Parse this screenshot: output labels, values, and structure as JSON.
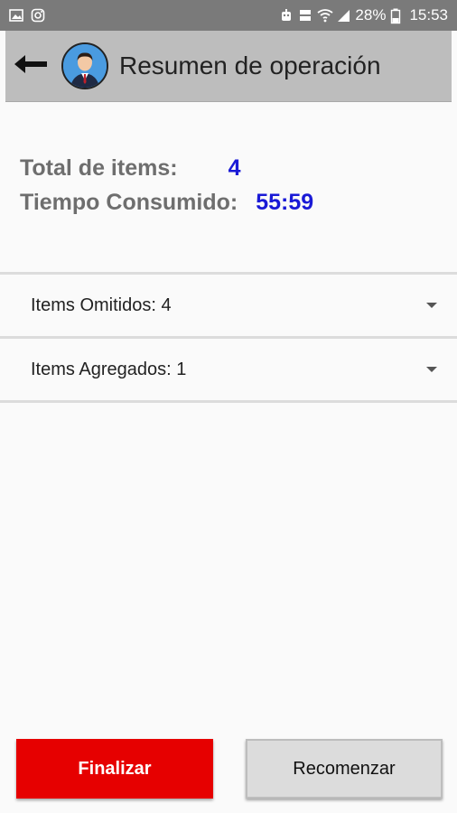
{
  "status_bar": {
    "battery": "28%",
    "time": "15:53",
    "icons": [
      "gallery-icon",
      "instagram-icon",
      "robot-icon",
      "wifi-icon",
      "signal-icon",
      "battery-icon"
    ]
  },
  "app_bar": {
    "title": "Resumen de operación",
    "back_icon": "arrow-left-icon",
    "avatar_icon": "user-avatar"
  },
  "summary": {
    "total_label": "Total de items:",
    "total_value": "4",
    "time_label": "Tiempo Consumido:",
    "time_value": "55:59"
  },
  "sections": [
    {
      "label": "Items Omitidos: 4"
    },
    {
      "label": "Items Agregados: 1"
    }
  ],
  "buttons": {
    "finish": "Finalizar",
    "restart": "Recomenzar"
  },
  "colors": {
    "accent_red": "#e60000",
    "value_blue": "#1a1ad6",
    "app_bar": "#bdbdbd",
    "status_bar": "#7a7a7a"
  }
}
